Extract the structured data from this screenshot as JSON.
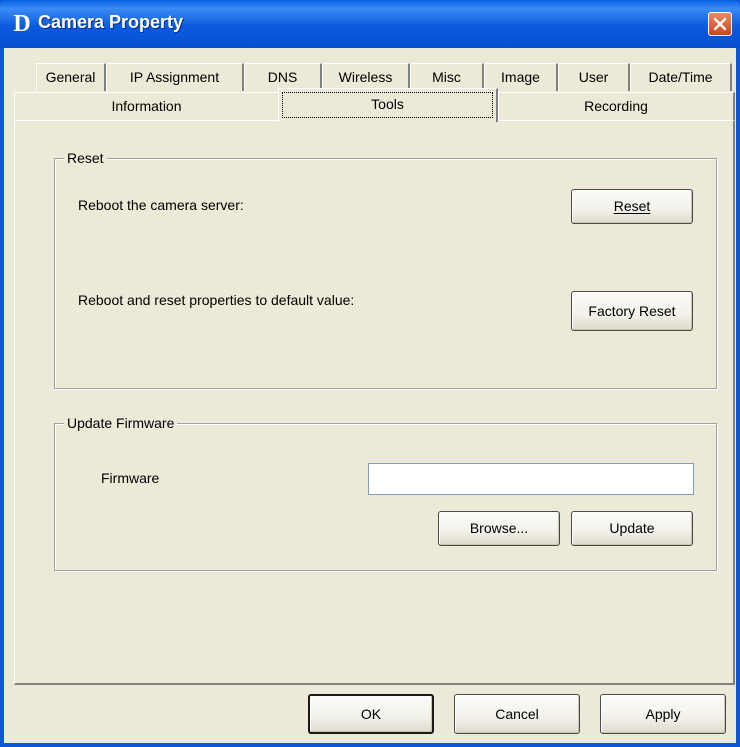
{
  "window": {
    "title": "Camera Property",
    "logo_letter": "D",
    "close_icon": "close-icon",
    "titlebar_color": "#0a5ae0",
    "close_color": "#d0431f"
  },
  "tabs": {
    "row1": [
      "General",
      "IP Assignment",
      "DNS",
      "Wireless",
      "Misc",
      "Image",
      "User",
      "Date/Time"
    ],
    "row2": [
      "Information",
      "Tools",
      "Recording"
    ],
    "selected": "Tools"
  },
  "reset_group": {
    "label": "Reset",
    "reboot_text": "Reboot the camera server:",
    "reset_button": "Reset",
    "factory_text": "Reboot and reset properties to default value:",
    "factory_button": "Factory Reset"
  },
  "firmware_group": {
    "label": "Update Firmware",
    "firmware_label": "Firmware",
    "firmware_value": "",
    "browse_button": "Browse...",
    "update_button": "Update"
  },
  "footer": {
    "ok_button": "OK",
    "cancel_button": "Cancel",
    "apply_button": "Apply"
  }
}
